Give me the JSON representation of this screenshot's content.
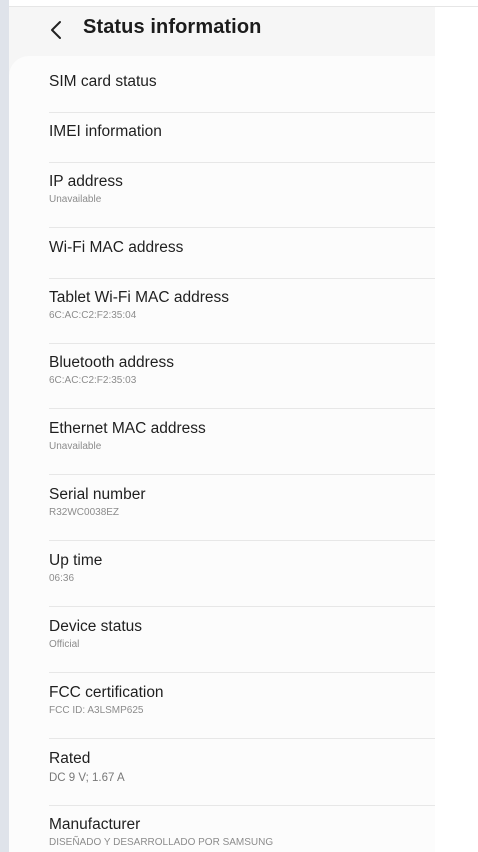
{
  "header": {
    "title": "Status information",
    "back_icon": "chevron-left-icon"
  },
  "items": [
    {
      "title": "SIM card status",
      "subtitle": ""
    },
    {
      "title": "IMEI information",
      "subtitle": ""
    },
    {
      "title": "IP address",
      "subtitle": "Unavailable"
    },
    {
      "title": "Wi-Fi MAC address",
      "subtitle": ""
    },
    {
      "title": "Tablet Wi-Fi MAC address",
      "subtitle": "6C:AC:C2:F2:35:04"
    },
    {
      "title": "Bluetooth address",
      "subtitle": "6C:AC:C2:F2:35:03"
    },
    {
      "title": "Ethernet MAC address",
      "subtitle": "Unavailable"
    },
    {
      "title": "Serial number",
      "subtitle": "R32WC0038EZ"
    },
    {
      "title": "Up time",
      "subtitle": "06:36"
    },
    {
      "title": "Device status",
      "subtitle": "Official"
    },
    {
      "title": "FCC certification",
      "subtitle": "FCC ID: A3LSMP625"
    },
    {
      "title": "Rated",
      "subtitle": "DC 9 V; 1.67 A"
    },
    {
      "title": "Manufacturer",
      "subtitle": "DISEÑADO Y DESARROLLADO POR SAMSUNG"
    }
  ]
}
